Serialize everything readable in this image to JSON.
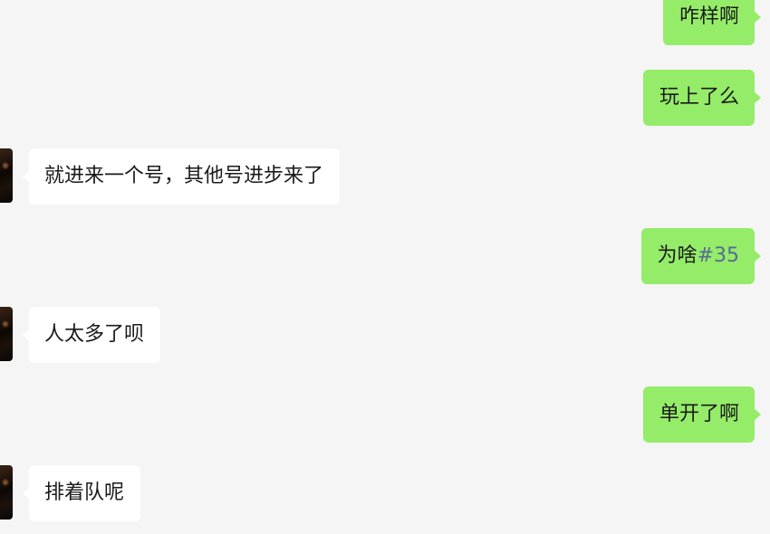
{
  "messages": [
    {
      "side": "out",
      "text": "咋样啊"
    },
    {
      "side": "out",
      "text": "玩上了么"
    },
    {
      "side": "in",
      "text": "就进来一个号，其他号进步来了"
    },
    {
      "side": "out",
      "text": "为啥",
      "link": "#35"
    },
    {
      "side": "in",
      "text": "人太多了呗"
    },
    {
      "side": "out",
      "text": "单开了啊"
    },
    {
      "side": "in",
      "text": "排着队呢"
    }
  ],
  "colors": {
    "background": "#f5f5f5",
    "outgoing_bubble": "#95ec69",
    "incoming_bubble": "#ffffff",
    "link": "#576b95"
  }
}
